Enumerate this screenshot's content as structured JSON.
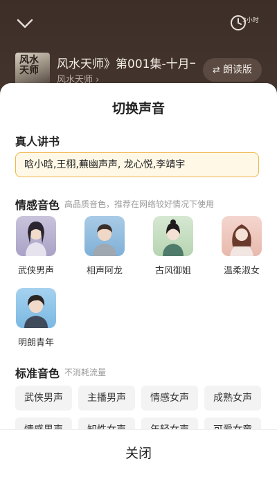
{
  "player": {
    "timer_label": "3小时",
    "title": "风水天师》第001集-十月一，",
    "author": "风水天师 ›",
    "read_button": "朗读版",
    "cover_text": "风水天师"
  },
  "sheet": {
    "title": "切换声音",
    "human_section": {
      "title": "真人讲书",
      "readers": "晗小晗,王栩,蕪幽声声, 龙心悦,李靖宇"
    },
    "emotion_section": {
      "title": "情感音色",
      "hint": "高品质音色，推荐在网络较好情况下使用",
      "voices": [
        {
          "label": "武侠男声"
        },
        {
          "label": "相声阿龙"
        },
        {
          "label": "古风御姐"
        },
        {
          "label": "温柔淑女"
        },
        {
          "label": "明朗青年"
        }
      ]
    },
    "standard_section": {
      "title": "标准音色",
      "hint": "不消耗流量",
      "chips_row1": [
        "武侠男声",
        "主播男声",
        "情感女声",
        "成熟女声"
      ],
      "chips_row2": [
        "情感男声",
        "知性女声",
        "年轻女声",
        "可爱女童"
      ]
    },
    "close_label": "关闭"
  },
  "colors": {
    "accent_border": "#f0b64a",
    "accent_fill": "#fff8e6"
  }
}
